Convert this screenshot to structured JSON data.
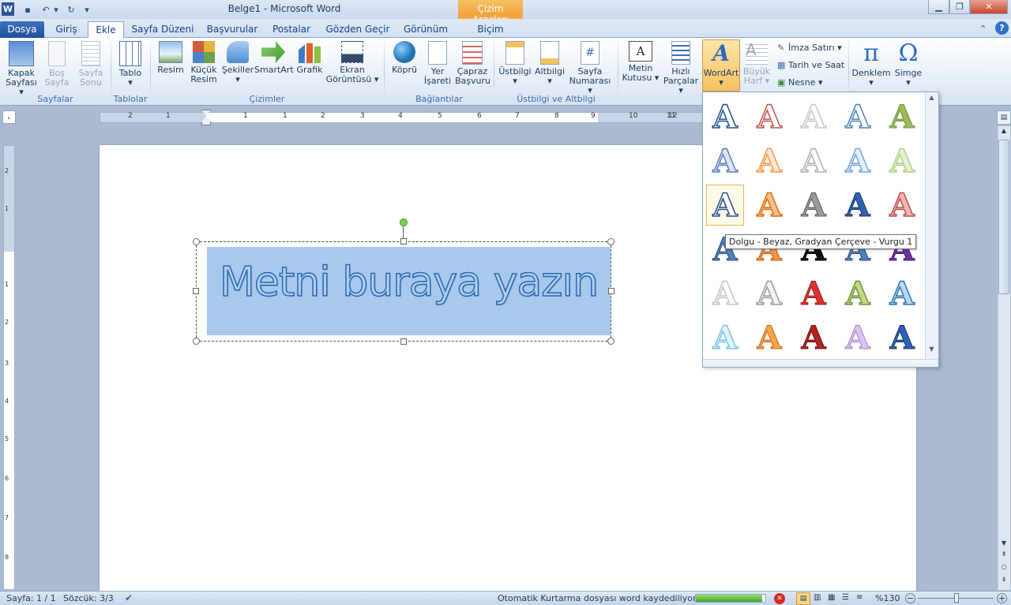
{
  "app": {
    "title": "Belge1  -  Microsoft Word",
    "context_tab_group": "Çizim Araçları",
    "context_tab": "Biçim"
  },
  "tabs": [
    "Dosya",
    "Giriş",
    "Ekle",
    "Sayfa Düzeni",
    "Başvurular",
    "Postalar",
    "Gözden Geçir",
    "Görünüm"
  ],
  "ribbon": {
    "buttons": [
      {
        "l1": "Kapak",
        "l2": "Sayfası ▾"
      },
      {
        "l1": "Boş",
        "l2": "Sayfa"
      },
      {
        "l1": "Sayfa",
        "l2": "Sonu"
      },
      {
        "l1": "Tablo",
        "l2": "▾"
      },
      {
        "l1": "Resim",
        "l2": ""
      },
      {
        "l1": "Küçük",
        "l2": "Resim"
      },
      {
        "l1": "Şekiller",
        "l2": "▾"
      },
      {
        "l1": "SmartArt",
        "l2": ""
      },
      {
        "l1": "Grafik",
        "l2": ""
      },
      {
        "l1": "Ekran",
        "l2": "Görüntüsü ▾"
      },
      {
        "l1": "Köprü",
        "l2": ""
      },
      {
        "l1": "Yer",
        "l2": "İşareti"
      },
      {
        "l1": "Çapraz",
        "l2": "Başvuru"
      },
      {
        "l1": "Üstbilgi",
        "l2": "▾"
      },
      {
        "l1": "Altbilgi",
        "l2": "▾"
      },
      {
        "l1": "Sayfa",
        "l2": "Numarası ▾"
      },
      {
        "l1": "Metin",
        "l2": "Kutusu ▾"
      },
      {
        "l1": "Hızlı",
        "l2": "Parçalar ▾"
      },
      {
        "l1": "WordArt",
        "l2": "▾"
      },
      {
        "l1": "Büyük",
        "l2": "Harf ▾"
      },
      {
        "l1": "Denklem",
        "l2": "▾"
      },
      {
        "l1": "Simge",
        "l2": "▾"
      }
    ],
    "small": [
      "İmza Satırı ▾",
      "Tarih ve Saat",
      "Nesne ▾"
    ],
    "groups": [
      "Sayfalar",
      "Tablolar",
      "Çizimler",
      "Bağlantılar",
      "Üstbilgi ve Altbilgi"
    ]
  },
  "ruler_numbers": [
    "2",
    "1",
    "1",
    "1",
    "2",
    "3",
    "4",
    "5",
    "6",
    "7",
    "8",
    "9",
    "10",
    "11",
    "12"
  ],
  "vruler_numbers": [
    "2",
    "1",
    "1",
    "1",
    "2",
    "3",
    "4",
    "5",
    "6",
    "7",
    "8"
  ],
  "document": {
    "wordart_text": "Metni buraya yazın"
  },
  "gallery": {
    "tooltip": "Dolgu - Beyaz, Gradyan Çerçeve - Vurgu 1",
    "letter": "A"
  },
  "status": {
    "page": "Sayfa: 1 / 1",
    "words": "Sözcük: 3/3",
    "autosave": "Otomatik Kurtarma dosyası word kaydediliyor:",
    "progress": 0.95,
    "zoom": "%130"
  },
  "colors": {
    "accent": "#2a5da8",
    "file_tab": "#2b579a",
    "selection": "#a9c9ec"
  }
}
